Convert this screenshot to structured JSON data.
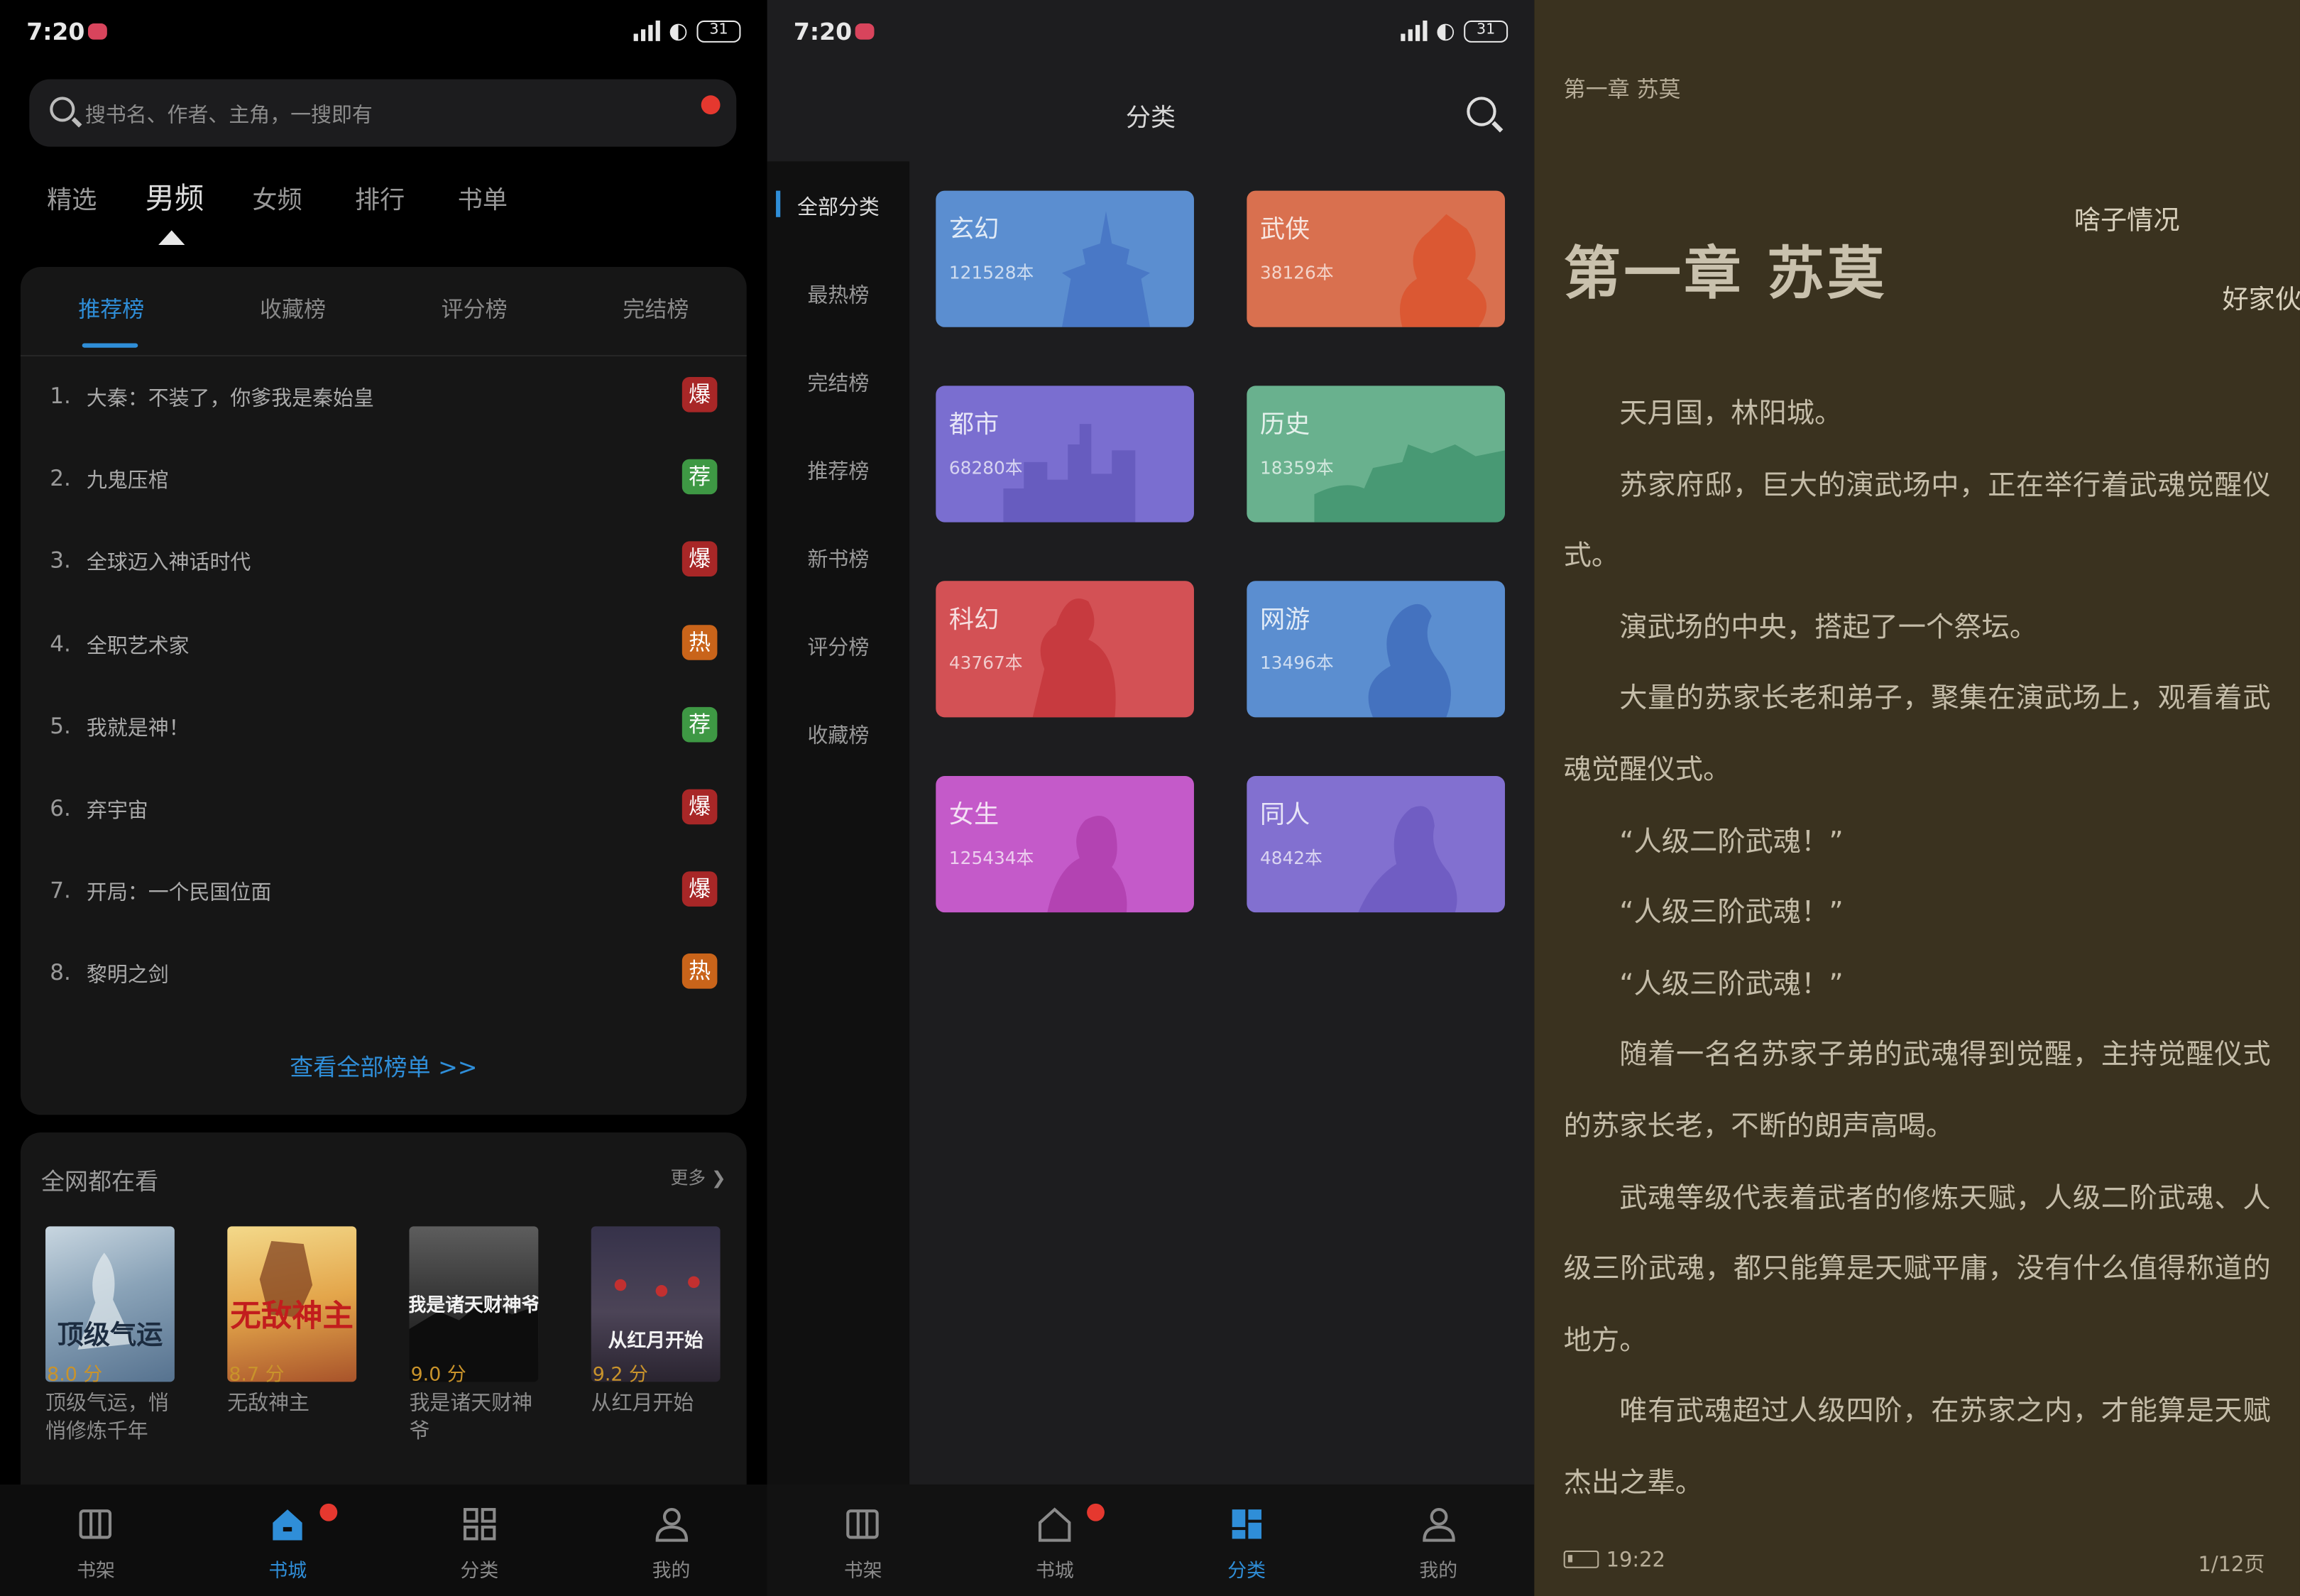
{
  "status": {
    "time": "7:20",
    "battery": "31"
  },
  "store": {
    "search_placeholder": "搜书名、作者、主角，一搜即有",
    "tabs": [
      "精选",
      "男频",
      "女频",
      "排行",
      "书单"
    ],
    "active_tab": "男频",
    "rank_tabs": [
      "推荐榜",
      "收藏榜",
      "评分榜",
      "完结榜"
    ],
    "rank_items": [
      {
        "num": "1.",
        "title": "大秦：不装了，你爹我是秦始皇",
        "badge": "爆"
      },
      {
        "num": "2.",
        "title": "九鬼压棺",
        "badge": "荐"
      },
      {
        "num": "3.",
        "title": "全球迈入神话时代",
        "badge": "爆"
      },
      {
        "num": "4.",
        "title": "全职艺术家",
        "badge": "热"
      },
      {
        "num": "5.",
        "title": "我就是神！",
        "badge": "荐"
      },
      {
        "num": "6.",
        "title": "弃宇宙",
        "badge": "爆"
      },
      {
        "num": "7.",
        "title": "开局：一个民国位面",
        "badge": "爆"
      },
      {
        "num": "8.",
        "title": "黎明之剑",
        "badge": "热"
      }
    ],
    "view_all": "查看全部榜单 >>",
    "watch_title": "全网都在看",
    "watch_more": "更多",
    "books": [
      {
        "title": "顶级气运，悄悄修炼千年",
        "score": "8.0 分",
        "cover_text": "顶级气运"
      },
      {
        "title": "无敌神主",
        "score": "8.7 分",
        "cover_text": "无敌神主"
      },
      {
        "title": "我是诸天财神爷",
        "score": "9.0 分",
        "cover_text": "我是诸天财神爷"
      },
      {
        "title": "从红月开始",
        "score": "9.2 分",
        "cover_text": "从红月开始"
      }
    ]
  },
  "nav": [
    "书架",
    "书城",
    "分类",
    "我的"
  ],
  "category": {
    "title": "分类",
    "side": [
      "全部分类",
      "最热榜",
      "完结榜",
      "推荐榜",
      "新书榜",
      "评分榜",
      "收藏榜"
    ],
    "cards": [
      {
        "name": "玄幻",
        "count": "121528本",
        "color": "#5b8ed0"
      },
      {
        "name": "武侠",
        "count": "38126本",
        "color": "#d9704f"
      },
      {
        "name": "都市",
        "count": "68280本",
        "color": "#7a6ed0"
      },
      {
        "name": "历史",
        "count": "18359本",
        "color": "#69b18e"
      },
      {
        "name": "科幻",
        "count": "43767本",
        "color": "#d35155"
      },
      {
        "name": "网游",
        "count": "13496本",
        "color": "#5b8ed0"
      },
      {
        "name": "女生",
        "count": "125434本",
        "color": "#c45ac9"
      },
      {
        "name": "同人",
        "count": "4842本",
        "color": "#8270d0"
      }
    ]
  },
  "reader": {
    "header": "第一章 苏莫",
    "chapter_title": "第一章 苏莫",
    "bullet1": "啥子情况",
    "bullet2": "好家伙",
    "paragraphs": [
      "天月国，林阳城。",
      "苏家府邸，巨大的演武场中，正在举行着武魂觉醒仪式。",
      "演武场的中央，搭起了一个祭坛。",
      "大量的苏家长老和弟子，聚集在演武场上，观看着武魂觉醒仪式。",
      "“人级二阶武魂！”",
      "“人级三阶武魂！”",
      "“人级三阶武魂！”",
      "随着一名名苏家子弟的武魂得到觉醒，主持觉醒仪式的苏家长老，不断的朗声高喝。",
      "武魂等级代表着武者的修炼天赋，人级二阶武魂、人级三阶武魂，都只能算是天赋平庸，没有什么值得称道的地方。",
      "唯有武魂超过人级四阶，在苏家之内，才能算是天赋杰出之辈。"
    ],
    "time": "19:22",
    "page": "1/12页"
  }
}
